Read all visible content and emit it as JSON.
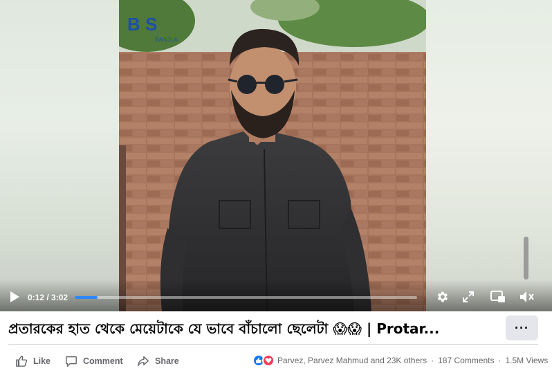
{
  "video": {
    "logo_text": "B S",
    "logo_sub": "BANGLA",
    "time_current": "0:12",
    "time_separator": " / ",
    "time_total": "3:02",
    "progress_fraction": 0.066
  },
  "post": {
    "title": "প্রতারকের হাত থেকে মেয়েটাকে যে ভাবে বাঁচালো ছেলেটা 😱😱 | Protar...",
    "more_label": "···"
  },
  "actions": {
    "like": "Like",
    "comment": "Comment",
    "share": "Share"
  },
  "stats": {
    "reactors": "Parvez, Parvez Mahmud and 23K others",
    "dot": "·",
    "comments": "187 Comments",
    "views": "1.5M Views"
  },
  "colors": {
    "accent": "#2d88ff",
    "like_blue": "#1877f2",
    "love_red": "#f33e58",
    "muted_text": "#65676b"
  },
  "icons": [
    "play-icon",
    "gear-icon",
    "expand-icon",
    "pip-icon",
    "mute-icon",
    "thumbs-up-icon",
    "comment-icon",
    "share-icon",
    "ellipsis-icon"
  ]
}
